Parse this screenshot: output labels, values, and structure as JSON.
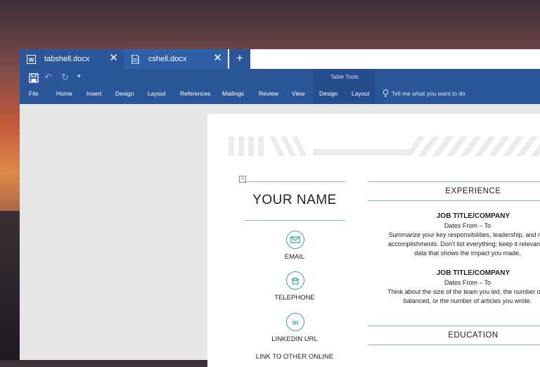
{
  "tabs": [
    {
      "label": "tabshell.docx",
      "icon": "word-icon",
      "close": "✕"
    },
    {
      "label": "cshell.docx",
      "icon": "document-icon",
      "close": "✕"
    }
  ],
  "new_tab": "+",
  "ribbon": {
    "contextual_title": "Table Tools",
    "menu": [
      "File",
      "Home",
      "Insert",
      "Design",
      "Layout",
      "References",
      "Mailings",
      "Review",
      "View",
      "Design",
      "Layout"
    ],
    "tell_me": "Tell me what you want to do"
  },
  "resume": {
    "name": "YOUR NAME",
    "contacts": [
      "EMAIL",
      "TELEPHONE",
      "LINKEDIN URL",
      "LINK TO OTHER ONLINE"
    ],
    "experience_title": "EXPERIENCE",
    "jobs": [
      {
        "title": "JOB TITLE/COMPANY",
        "dates": "Dates From – To",
        "lines": [
          "Summarize your key responsibilities, leadership, and mo",
          "accomplishments. Don't list everything; keep it relevant a",
          "data that shows the impact you made."
        ]
      },
      {
        "title": "JOB TITLE/COMPANY",
        "dates": "Dates From – To",
        "lines": [
          "Think about the size of the team you led, the number of p",
          "balanced, or the number of articles you wrote."
        ]
      }
    ],
    "education_title": "EDUCATION"
  },
  "colors": {
    "ribbon": "#2b579a",
    "accent_teal": "#3aa8a0"
  }
}
